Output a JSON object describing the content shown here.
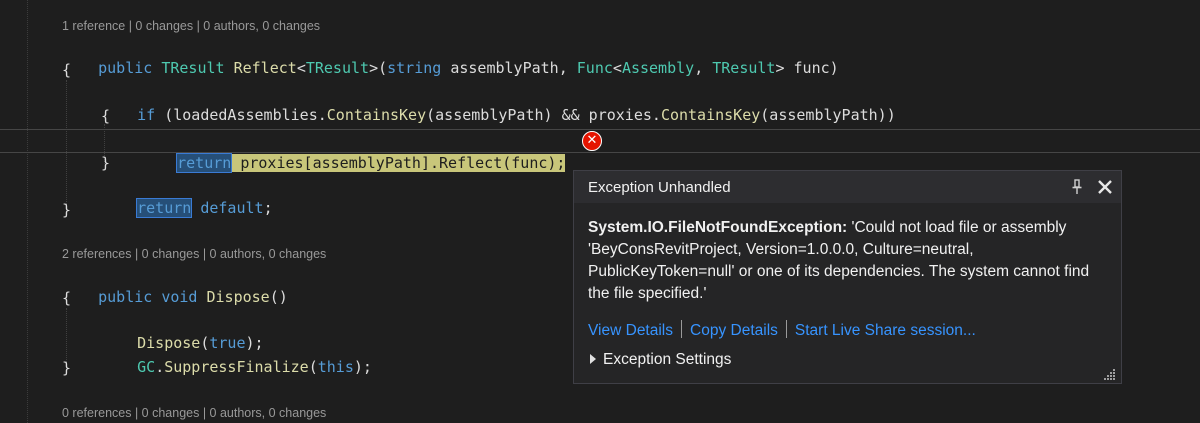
{
  "code_lens": {
    "reflect": "1 reference | 0 changes | 0 authors, 0 changes",
    "dispose": "2 references | 0 changes | 0 authors, 0 changes",
    "next": "0 references | 0 changes | 0 authors, 0 changes"
  },
  "code": {
    "l1": {
      "kw_public": "public",
      "ty_tresult": "TResult",
      "fn_reflect": "Reflect",
      "p1": "<",
      "ty_tresult2": "TResult",
      "p2": ">(",
      "kw_string": "string",
      "p3": " assemblyPath, ",
      "ty_func": "Func",
      "p4": "<",
      "ty_assembly": "Assembly",
      "p5": ", ",
      "ty_tresult3": "TResult",
      "p6": "> func)"
    },
    "l2": "{",
    "l3": {
      "kw_if": "if",
      "p1": " (loadedAssemblies.",
      "fn_ck1": "ContainsKey",
      "p2": "(assemblyPath) && proxies.",
      "fn_ck2": "ContainsKey",
      "p3": "(assemblyPath))"
    },
    "l4": "{",
    "l5": {
      "kw_return": "return",
      "rest": " proxies[assemblyPath].Reflect(func);"
    },
    "l6": "}",
    "l7": {
      "kw_return": "return",
      "kw_default": "default",
      "p1": ";"
    },
    "l8": "}",
    "l9": {
      "kw_public": "public",
      "kw_void": "void",
      "fn_dispose": "Dispose",
      "p1": "()"
    },
    "l10": "{",
    "l11": {
      "fn_dispose": "Dispose",
      "p1": "(",
      "kw_true": "true",
      "p2": ");"
    },
    "l12": {
      "ty_gc": "GC",
      "p1": ".",
      "fn_suppress": "SuppressFinalize",
      "p2": "(",
      "kw_this": "this",
      "p3": ");"
    },
    "l13": "}"
  },
  "exception_popup": {
    "title": "Exception Unhandled",
    "exception_type": "System.IO.FileNotFoundException:",
    "message": " 'Could not load file or assembly 'BeyConsRevitProject, Version=1.0.0.0, Culture=neutral, PublicKeyToken=null' or one of its dependencies. The system cannot find the file specified.'",
    "links": [
      "View Details",
      "Copy Details",
      "Start Live Share session..."
    ],
    "settings_label": "Exception Settings"
  },
  "colors": {
    "background": "#1e1e1e",
    "keyword": "#569cd6",
    "type": "#4ec9b0",
    "method": "#dcdcaa",
    "link": "#3794ff",
    "error": "#e51400",
    "statement_highlight": "#c8c67a"
  },
  "icons": {
    "error": "error-icon",
    "pin": "pin-icon",
    "close": "close-icon",
    "expand": "chevron-right-icon",
    "resize": "resize-grip-icon"
  }
}
